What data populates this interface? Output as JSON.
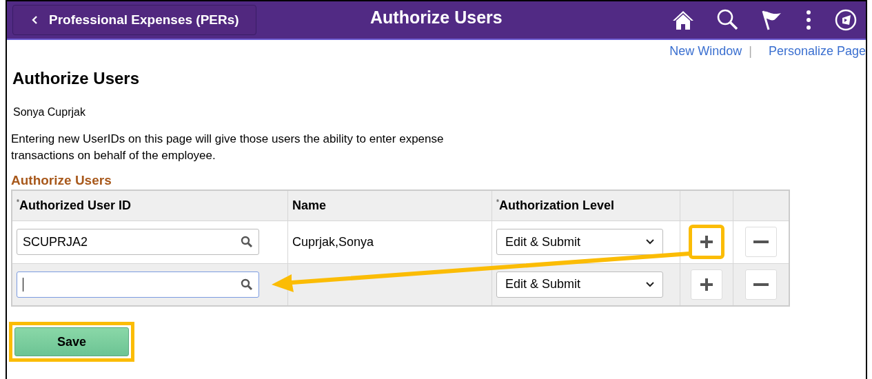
{
  "header": {
    "back_label": "Professional Expenses (PERs)",
    "title": "Authorize Users"
  },
  "links": [
    {
      "label": "New Window"
    },
    {
      "label": "Personalize Page"
    }
  ],
  "link_separator": "|",
  "page_title": "Authorize Users",
  "employee_name": "Sonya Cuprjak",
  "description": "Entering new UserIDs on this page will give those users the ability to enter expense transactions on behalf of the employee.",
  "section_title": "Authorize Users",
  "table": {
    "columns": [
      {
        "label": "Authorized User ID",
        "required_mark": "*"
      },
      {
        "label": "Name"
      },
      {
        "label": "Authorization Level",
        "required_mark": "*"
      }
    ],
    "rows": [
      {
        "user_id": "SCUPRJA2",
        "focused": false,
        "name": "Cuprjak,Sonya",
        "level": "Edit & Submit",
        "add_highlighted": true
      },
      {
        "user_id": "",
        "focused": true,
        "name": "",
        "level": "Edit & Submit",
        "add_highlighted": false
      }
    ]
  },
  "save": {
    "label": "Save",
    "highlighted": true
  }
}
